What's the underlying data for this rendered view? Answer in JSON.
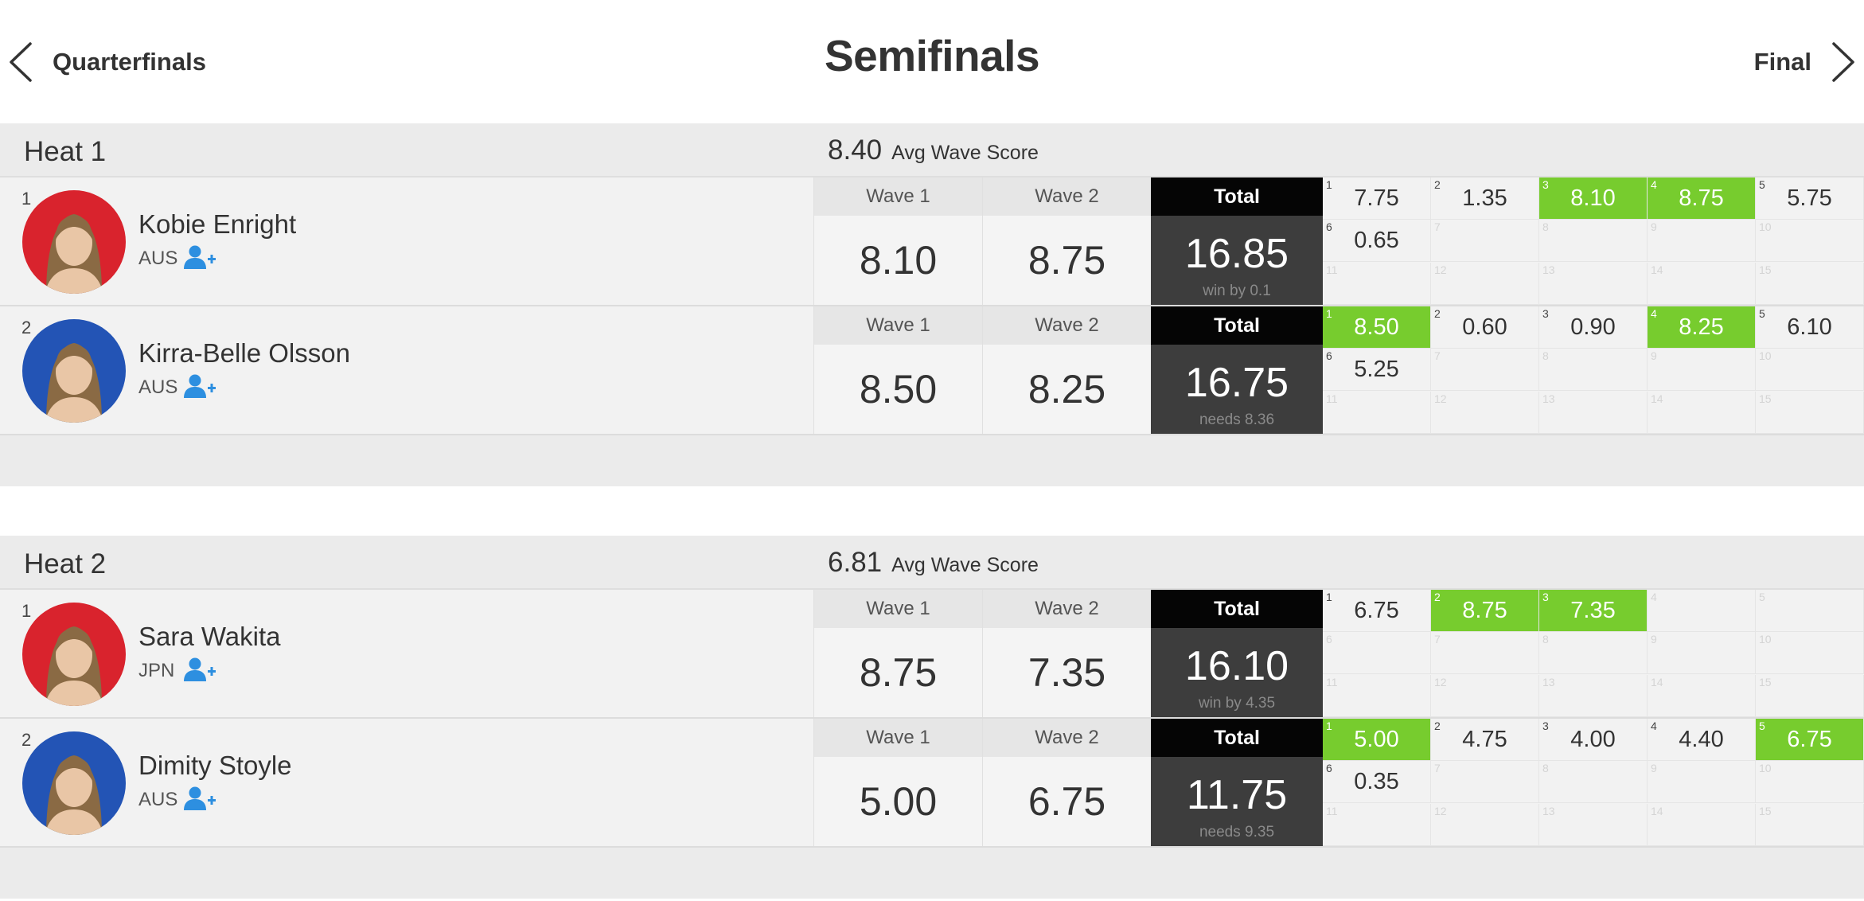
{
  "nav": {
    "prev_label": "Quarterfinals",
    "title": "Semifinals",
    "next_label": "Final"
  },
  "colors": {
    "highlight": "#77cc2e",
    "total_bg": "#3d3d3d",
    "avatar_red": "#d9232d",
    "avatar_blue": "#2354b5",
    "follow_icon": "#2d8fe0"
  },
  "labels": {
    "avg": "Avg Wave Score",
    "wave1": "Wave 1",
    "wave2": "Wave 2",
    "total": "Total"
  },
  "heats": [
    {
      "name": "Heat 1",
      "avg": "8.40",
      "athletes": [
        {
          "seed": "1",
          "name": "Kobie Enright",
          "country": "AUS",
          "avatar_color": "red",
          "wave1": "8.10",
          "wave2": "8.75",
          "total": "16.85",
          "note": "win by 0.1",
          "scores": [
            {
              "n": "1",
              "v": "7.75",
              "hl": false
            },
            {
              "n": "2",
              "v": "1.35",
              "hl": false
            },
            {
              "n": "3",
              "v": "8.10",
              "hl": true
            },
            {
              "n": "4",
              "v": "8.75",
              "hl": true
            },
            {
              "n": "5",
              "v": "5.75",
              "hl": false
            },
            {
              "n": "6",
              "v": "0.65",
              "hl": false
            },
            {
              "n": "7",
              "v": "",
              "hl": false
            },
            {
              "n": "8",
              "v": "",
              "hl": false
            },
            {
              "n": "9",
              "v": "",
              "hl": false
            },
            {
              "n": "10",
              "v": "",
              "hl": false
            },
            {
              "n": "11",
              "v": "",
              "hl": false
            },
            {
              "n": "12",
              "v": "",
              "hl": false
            },
            {
              "n": "13",
              "v": "",
              "hl": false
            },
            {
              "n": "14",
              "v": "",
              "hl": false
            },
            {
              "n": "15",
              "v": "",
              "hl": false
            }
          ]
        },
        {
          "seed": "2",
          "name": "Kirra-Belle Olsson",
          "country": "AUS",
          "avatar_color": "blue",
          "wave1": "8.50",
          "wave2": "8.25",
          "total": "16.75",
          "note": "needs 8.36",
          "scores": [
            {
              "n": "1",
              "v": "8.50",
              "hl": true
            },
            {
              "n": "2",
              "v": "0.60",
              "hl": false
            },
            {
              "n": "3",
              "v": "0.90",
              "hl": false
            },
            {
              "n": "4",
              "v": "8.25",
              "hl": true
            },
            {
              "n": "5",
              "v": "6.10",
              "hl": false
            },
            {
              "n": "6",
              "v": "5.25",
              "hl": false
            },
            {
              "n": "7",
              "v": "",
              "hl": false
            },
            {
              "n": "8",
              "v": "",
              "hl": false
            },
            {
              "n": "9",
              "v": "",
              "hl": false
            },
            {
              "n": "10",
              "v": "",
              "hl": false
            },
            {
              "n": "11",
              "v": "",
              "hl": false
            },
            {
              "n": "12",
              "v": "",
              "hl": false
            },
            {
              "n": "13",
              "v": "",
              "hl": false
            },
            {
              "n": "14",
              "v": "",
              "hl": false
            },
            {
              "n": "15",
              "v": "",
              "hl": false
            }
          ]
        }
      ]
    },
    {
      "name": "Heat 2",
      "avg": "6.81",
      "athletes": [
        {
          "seed": "1",
          "name": "Sara Wakita",
          "country": "JPN",
          "avatar_color": "red",
          "wave1": "8.75",
          "wave2": "7.35",
          "total": "16.10",
          "note": "win by 4.35",
          "scores": [
            {
              "n": "1",
              "v": "6.75",
              "hl": false
            },
            {
              "n": "2",
              "v": "8.75",
              "hl": true
            },
            {
              "n": "3",
              "v": "7.35",
              "hl": true
            },
            {
              "n": "4",
              "v": "",
              "hl": false
            },
            {
              "n": "5",
              "v": "",
              "hl": false
            },
            {
              "n": "6",
              "v": "",
              "hl": false
            },
            {
              "n": "7",
              "v": "",
              "hl": false
            },
            {
              "n": "8",
              "v": "",
              "hl": false
            },
            {
              "n": "9",
              "v": "",
              "hl": false
            },
            {
              "n": "10",
              "v": "",
              "hl": false
            },
            {
              "n": "11",
              "v": "",
              "hl": false
            },
            {
              "n": "12",
              "v": "",
              "hl": false
            },
            {
              "n": "13",
              "v": "",
              "hl": false
            },
            {
              "n": "14",
              "v": "",
              "hl": false
            },
            {
              "n": "15",
              "v": "",
              "hl": false
            }
          ]
        },
        {
          "seed": "2",
          "name": "Dimity Stoyle",
          "country": "AUS",
          "avatar_color": "blue",
          "wave1": "5.00",
          "wave2": "6.75",
          "total": "11.75",
          "note": "needs 9.35",
          "scores": [
            {
              "n": "1",
              "v": "5.00",
              "hl": true
            },
            {
              "n": "2",
              "v": "4.75",
              "hl": false
            },
            {
              "n": "3",
              "v": "4.00",
              "hl": false
            },
            {
              "n": "4",
              "v": "4.40",
              "hl": false
            },
            {
              "n": "5",
              "v": "6.75",
              "hl": true
            },
            {
              "n": "6",
              "v": "0.35",
              "hl": false
            },
            {
              "n": "7",
              "v": "",
              "hl": false
            },
            {
              "n": "8",
              "v": "",
              "hl": false
            },
            {
              "n": "9",
              "v": "",
              "hl": false
            },
            {
              "n": "10",
              "v": "",
              "hl": false
            },
            {
              "n": "11",
              "v": "",
              "hl": false
            },
            {
              "n": "12",
              "v": "",
              "hl": false
            },
            {
              "n": "13",
              "v": "",
              "hl": false
            },
            {
              "n": "14",
              "v": "",
              "hl": false
            },
            {
              "n": "15",
              "v": "",
              "hl": false
            }
          ]
        }
      ]
    }
  ]
}
